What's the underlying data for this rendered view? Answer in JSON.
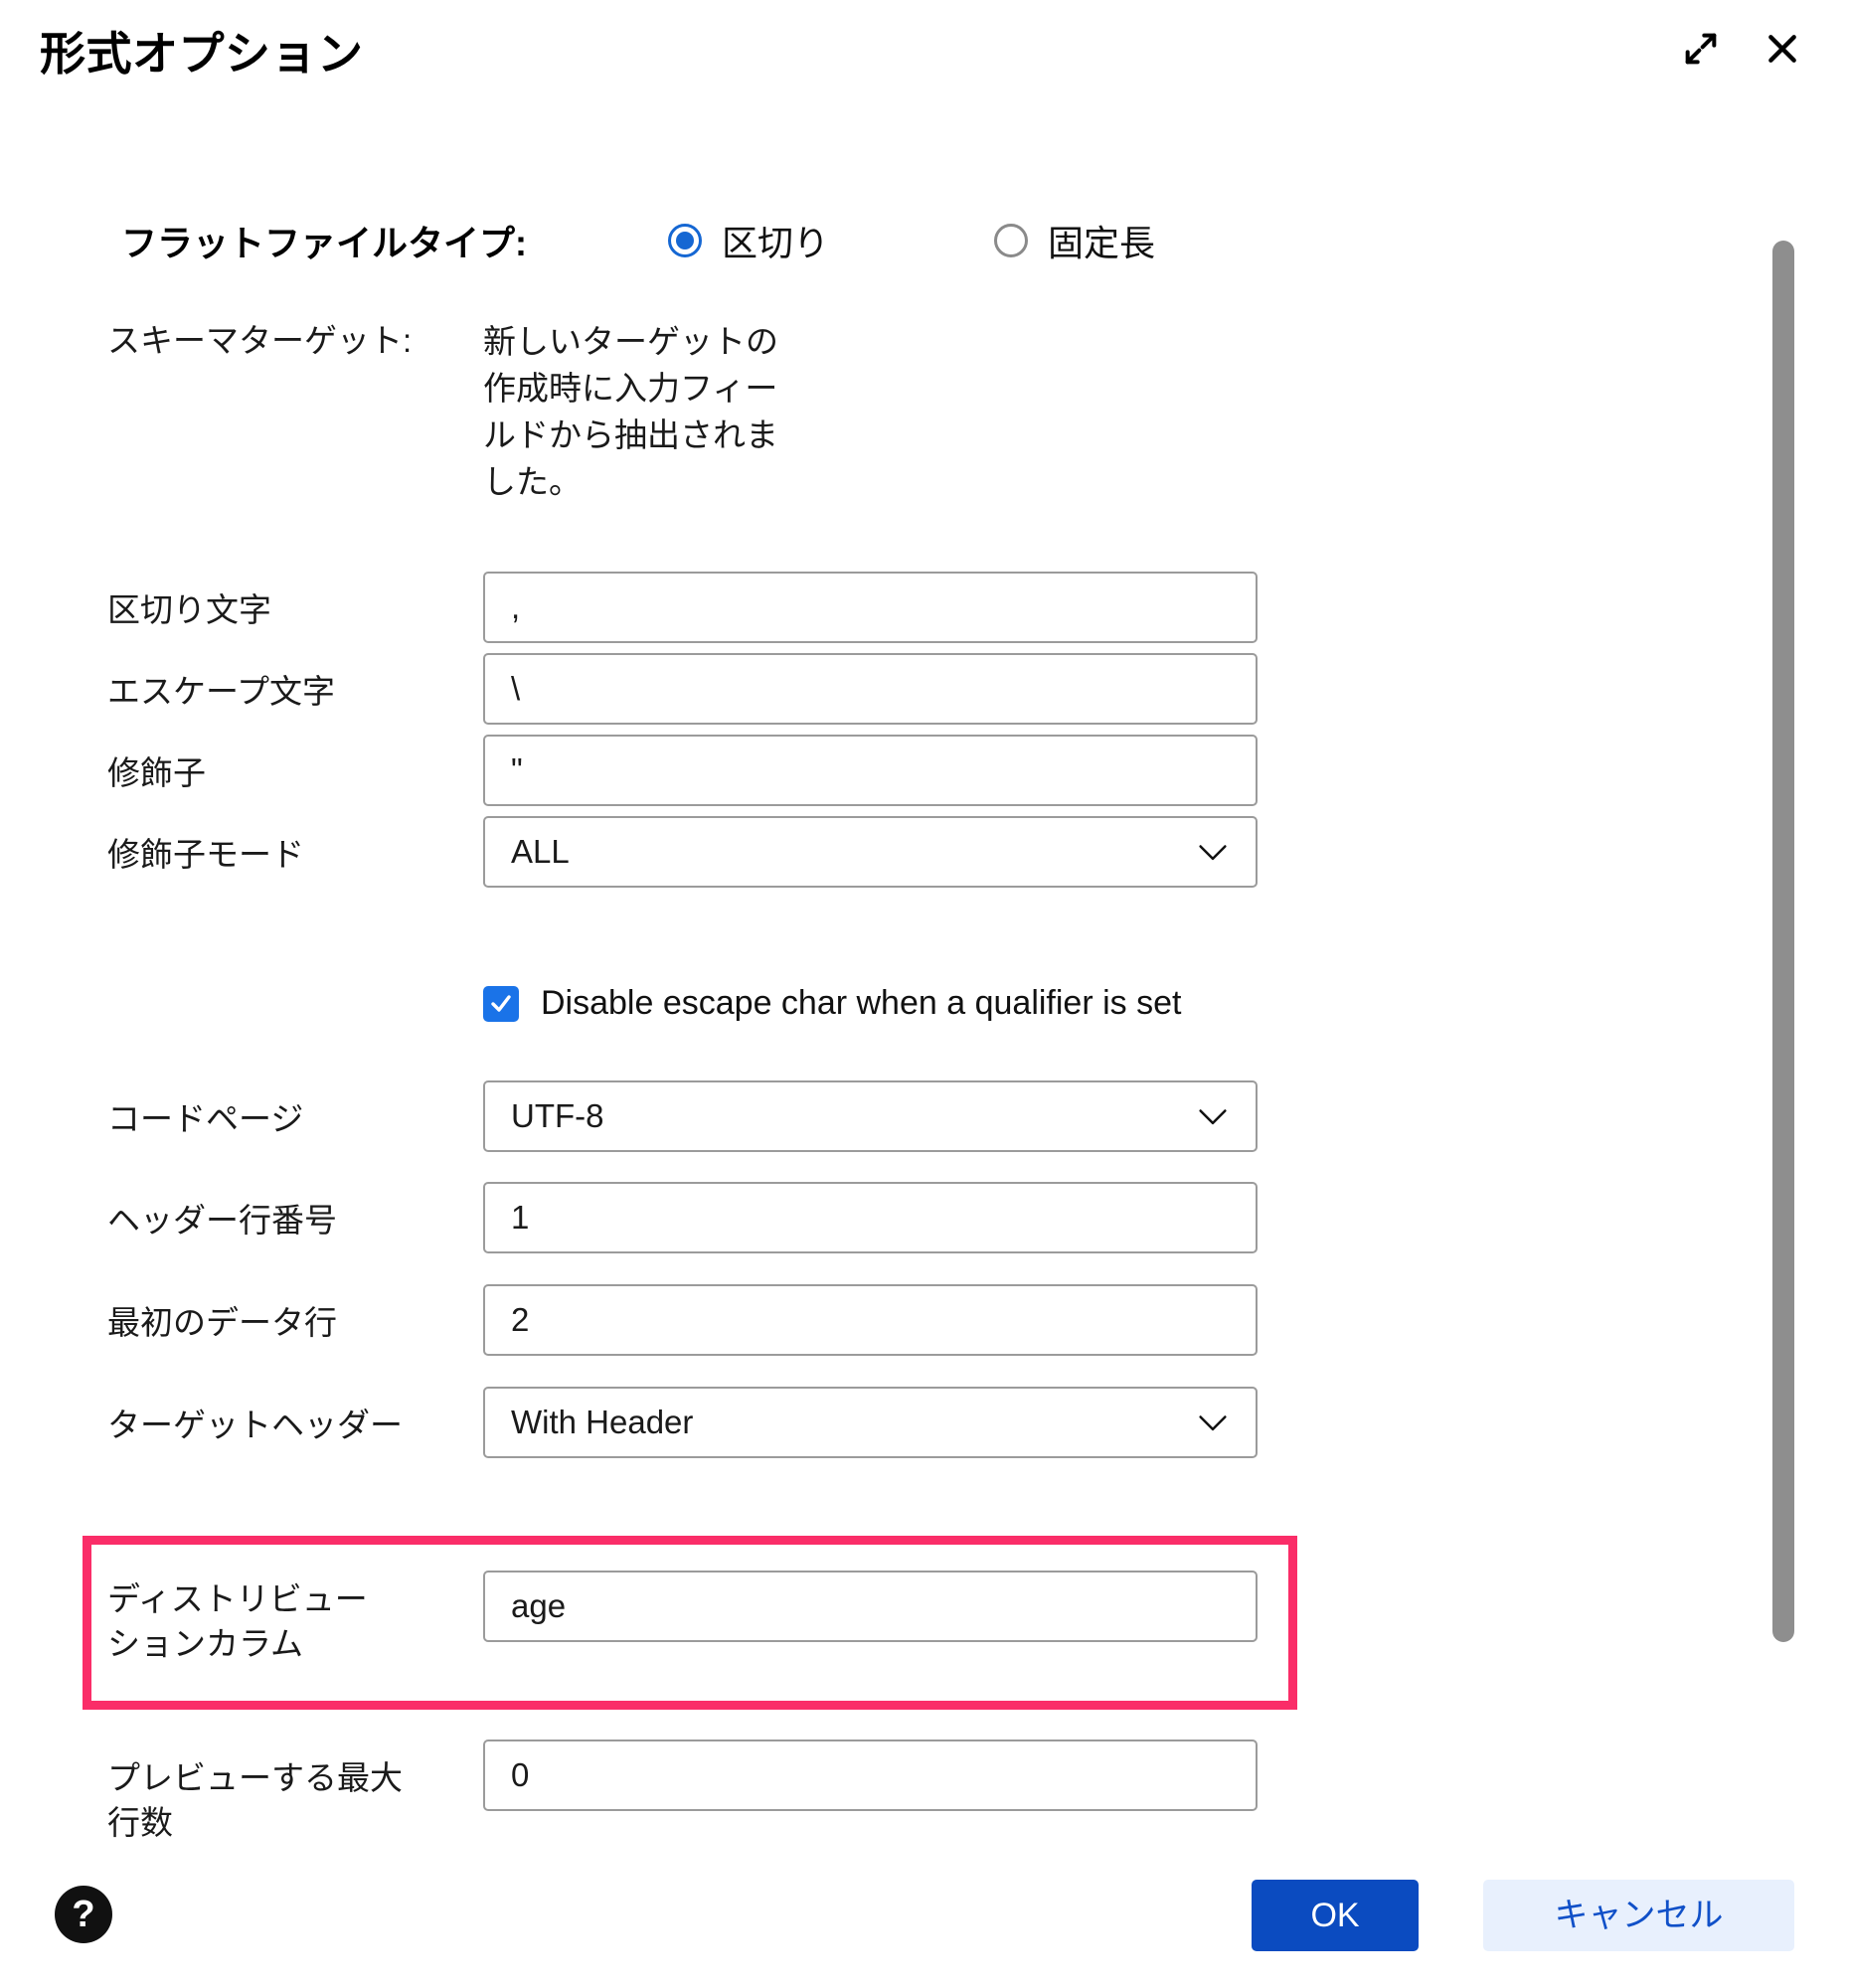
{
  "dialog": {
    "title": "形式オプション",
    "expand_icon": "expand-diagonal-icon",
    "close_icon": "close-icon"
  },
  "flat_file_type": {
    "label": "フラットファイルタイプ:",
    "options": [
      {
        "label": "区切り",
        "selected": true
      },
      {
        "label": "固定長",
        "selected": false
      }
    ]
  },
  "schema_target": {
    "label": "スキーマターゲット:",
    "description": "新しいターゲットの作成時に入力フィールドから抽出されました。"
  },
  "fields": {
    "delimiter": {
      "label": "区切り文字",
      "value": ","
    },
    "escape": {
      "label": "エスケープ文字",
      "value": "\\"
    },
    "qualifier": {
      "label": "修飾子",
      "value": "\""
    },
    "qualifier_mode": {
      "label": "修飾子モード",
      "value": "ALL"
    },
    "code_page": {
      "label": "コードページ",
      "value": "UTF-8"
    },
    "header_row_number": {
      "label": "ヘッダー行番号",
      "value": "1"
    },
    "first_data_row": {
      "label": "最初のデータ行",
      "value": "2"
    },
    "target_header": {
      "label": "ターゲットヘッダー",
      "value": "With Header"
    },
    "distribution_column": {
      "label": "ディストリビューションカラム",
      "value": "age"
    },
    "max_preview_rows": {
      "label": "プレビューする最大行数",
      "value": "0"
    }
  },
  "disable_escape_checkbox": {
    "label": "Disable escape char when a qualifier is set",
    "checked": true
  },
  "footer": {
    "help_label": "?",
    "ok_label": "OK",
    "cancel_label": "キャンセル"
  },
  "colors": {
    "accent_blue": "#0b4bc0",
    "radio_blue": "#1567d3",
    "checkbox_blue": "#1a73e8",
    "highlight_pink": "#fa2d68",
    "cancel_bg": "#e8f0fd",
    "cancel_text": "#1050c8",
    "field_border": "#9b9b9b",
    "scrollbar": "#8e8e8e"
  }
}
